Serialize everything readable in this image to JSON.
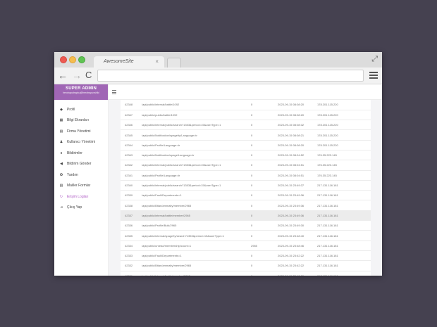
{
  "browser": {
    "tab_title": "AwesomeSite",
    "tab_close": "×",
    "nav_back": "←",
    "nav_forward": "→",
    "nav_reload": "C",
    "expand_symbol": "⤢",
    "address": ""
  },
  "sidebar": {
    "brand_title": "SUPER ADMIN",
    "brand_subtitle": "herobaputrapku@herotrapuvshiki",
    "items": [
      {
        "label": "Profil",
        "icon": "◆"
      },
      {
        "label": "Bilgi Ekranları",
        "icon": "▦"
      },
      {
        "label": "Firma Yönetimi",
        "icon": "▤"
      },
      {
        "label": "Kullanıcı Yönetimi",
        "icon": "♟"
      },
      {
        "label": "Bildirimler",
        "icon": "●"
      },
      {
        "label": "Bildirim Gönder",
        "icon": "◀"
      },
      {
        "label": "Yardım",
        "icon": "✪"
      },
      {
        "label": "Mailler Formlar",
        "icon": "▤"
      },
      {
        "label": "Erişim Logları",
        "icon": "↻"
      },
      {
        "label": "Çıkış Yap",
        "icon": "⇥"
      }
    ],
    "active_index": 8
  },
  "logs": {
    "rows": [
      {
        "id": "42348",
        "url": "/api/public/internal/battle/1092",
        "status": "0",
        "date": "2023-09-15 08:08:20",
        "ip": "178.201.115.220"
      },
      {
        "id": "42347",
        "url": "/api/public/public/battle/1092",
        "status": "0",
        "date": "2023-09-15 08:08:20",
        "ip": "178.201.115.220"
      },
      {
        "id": "42346",
        "url": "/api/public/internal/public/search?1353&period=15&userType=1",
        "status": "0",
        "date": "2023-09-15 08:08:32",
        "ip": "178.201.115.220"
      },
      {
        "id": "42345",
        "url": "/api/public/Notification/spage/ty/Language=tr",
        "status": "0",
        "date": "2023-09-15 08:08:21",
        "ip": "178.201.115.220"
      },
      {
        "id": "42344",
        "url": "/api/public/Profile/Language=tr",
        "status": "0",
        "date": "2023-09-15 08:08:20",
        "ip": "178.201.115.220"
      },
      {
        "id": "42343",
        "url": "/api/public/Notification/spage/Language=tr",
        "status": "0",
        "date": "2023-09-15 08:04:52",
        "ip": "176.35.223.145"
      },
      {
        "id": "42342",
        "url": "/api/public/internal/public/search?1353&period=15&userType=1",
        "status": "0",
        "date": "2023-09-15 08:04:51",
        "ip": "176.35.223.145"
      },
      {
        "id": "42341",
        "url": "/api/public/Profile/Language=tr",
        "status": "0",
        "date": "2023-09-15 08:04:51",
        "ip": "176.35.223.145"
      },
      {
        "id": "42340",
        "url": "/api/public/internal/public/search?1353&period=15&userType=1",
        "status": "0",
        "date": "2023-09-15 23:49:37",
        "ip": "217.131.116.181"
      },
      {
        "id": "42339",
        "url": "/api/public/Fault/Departments=1",
        "status": "0",
        "date": "2023-09-15 23:49:36",
        "ip": "217.131.116.181"
      },
      {
        "id": "42338",
        "url": "/api/public/Bitan/ammalty/member/2965",
        "status": "0",
        "date": "2023-09-15 23:49:36",
        "ip": "217.131.116.181"
      },
      {
        "id": "42337",
        "url": "/api/public/internal/battle/member/2965",
        "status": "0",
        "date": "2023-09-15 23:49:36",
        "ip": "217.131.116.181"
      },
      {
        "id": "42336",
        "url": "/api/public/Profile/Bulk/2965",
        "status": "0",
        "date": "2023-09-15 23:49:30",
        "ip": "217.131.116.181"
      },
      {
        "id": "42335",
        "url": "/api/public/internal/spage/ty/search?1353&period=15&userType=1",
        "status": "0",
        "date": "2023-09-15 23:48:40",
        "ip": "217.131.116.181"
      },
      {
        "id": "42334",
        "url": "/api/public/unread/membership/count=1",
        "status": "2965",
        "date": "2023-09-15 23:48:46",
        "ip": "217.131.116.181"
      },
      {
        "id": "42333",
        "url": "/api/public/Fault/Departments=1",
        "status": "0",
        "date": "2023-09-15 23:42:22",
        "ip": "217.131.116.181"
      },
      {
        "id": "42332",
        "url": "/api/public/Bitan/ammalty/member/2965",
        "status": "0",
        "date": "2023-09-15 23:42:22",
        "ip": "217.131.116.181"
      },
      {
        "id": "42331",
        "url": "/api/public/internal/battle/member/2965",
        "status": "0",
        "date": "2023-09-15 23:42:20",
        "ip": "217.131.116.181"
      }
    ],
    "highlighted_row": 11
  }
}
